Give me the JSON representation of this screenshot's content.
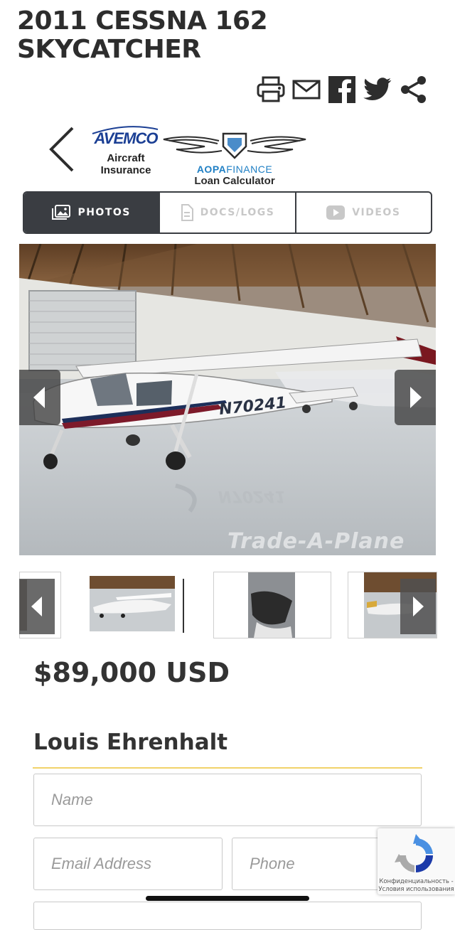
{
  "listing": {
    "title": "2011 CESSNA 162 SKYCATCHER",
    "price": "$89,000 USD",
    "seller": "Louis Ehrenhalt"
  },
  "share_icons": [
    "print-icon",
    "email-icon",
    "facebook-icon",
    "twitter-icon",
    "share-icon"
  ],
  "partners": {
    "avemco": {
      "logo": "AVEMCO",
      "label": "Aircraft Insurance"
    },
    "aopa": {
      "brand_bold": "AOPA",
      "brand_rest": "FINANCE",
      "label": "Loan Calculator"
    }
  },
  "tabs": [
    {
      "label": "PHOTOS",
      "icon": "photos-icon",
      "active": true
    },
    {
      "label": "DOCS/LOGS",
      "icon": "document-icon",
      "active": false
    },
    {
      "label": "VIDEOS",
      "icon": "video-icon",
      "active": false
    }
  ],
  "gallery": {
    "watermark": "Trade-A-Plane",
    "tail_number": "N70241"
  },
  "form": {
    "name_placeholder": "Name",
    "email_placeholder": "Email Address",
    "phone_placeholder": "Phone"
  },
  "recaptcha": {
    "line1": "Конфиденциальность -",
    "line2": "Условия использования"
  },
  "colors": {
    "tab_active": "#3a3d42",
    "accent_rule": "#f1d26a",
    "avemco_blue": "#1b3f94",
    "aopa_blue": "#1f7fc4"
  }
}
